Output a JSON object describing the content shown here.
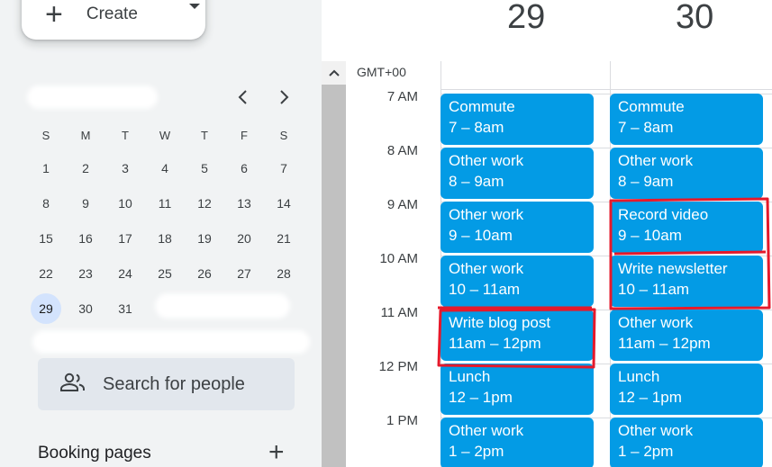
{
  "sidebar": {
    "create_label": "Create",
    "mini_calendar": {
      "days_of_week": [
        "S",
        "M",
        "T",
        "W",
        "T",
        "F",
        "S"
      ],
      "weeks": [
        [
          "1",
          "2",
          "3",
          "4",
          "5",
          "6",
          "7"
        ],
        [
          "8",
          "9",
          "10",
          "11",
          "12",
          "13",
          "14"
        ],
        [
          "15",
          "16",
          "17",
          "18",
          "19",
          "20",
          "21"
        ],
        [
          "22",
          "23",
          "24",
          "25",
          "26",
          "27",
          "28"
        ],
        [
          "29",
          "30",
          "31",
          "",
          "",
          "",
          ""
        ]
      ],
      "today": "29"
    },
    "search_people_placeholder": "Search for people",
    "booking_pages_label": "Booking pages"
  },
  "calendar": {
    "timezone": "GMT+00",
    "days": [
      {
        "number": "29"
      },
      {
        "number": "30"
      }
    ],
    "time_labels": [
      "7 AM",
      "8 AM",
      "9 AM",
      "10 AM",
      "11 AM",
      "12 PM",
      "1 PM"
    ],
    "events": [
      [
        {
          "title": "Commute",
          "time": "7 – 8am"
        },
        {
          "title": "Other work",
          "time": "8 – 9am"
        },
        {
          "title": "Other work",
          "time": "9 – 10am"
        },
        {
          "title": "Other work",
          "time": "10 – 11am"
        },
        {
          "title": "Write blog post",
          "time": "11am – 12pm"
        },
        {
          "title": "Lunch",
          "time": "12 – 1pm"
        },
        {
          "title": "Other work",
          "time": "1 – 2pm"
        }
      ],
      [
        {
          "title": "Commute",
          "time": "7 – 8am"
        },
        {
          "title": "Other work",
          "time": "8 – 9am"
        },
        {
          "title": "Record video",
          "time": "9 – 10am"
        },
        {
          "title": "Write newsletter",
          "time": "10 – 11am"
        },
        {
          "title": "Other work",
          "time": "11am – 12pm"
        },
        {
          "title": "Lunch",
          "time": "12 – 1pm"
        },
        {
          "title": "Other work",
          "time": "1 – 2pm"
        }
      ]
    ],
    "event_color": "#039be5",
    "annotation_color": "#e5192b"
  },
  "icons": {
    "create": "plus-icon",
    "create_menu": "caret-down-icon",
    "prev_month": "chevron-left-icon",
    "next_month": "chevron-right-icon",
    "search_people": "people-icon",
    "add_booking": "plus-icon",
    "scroll_up": "chevron-up-icon"
  }
}
